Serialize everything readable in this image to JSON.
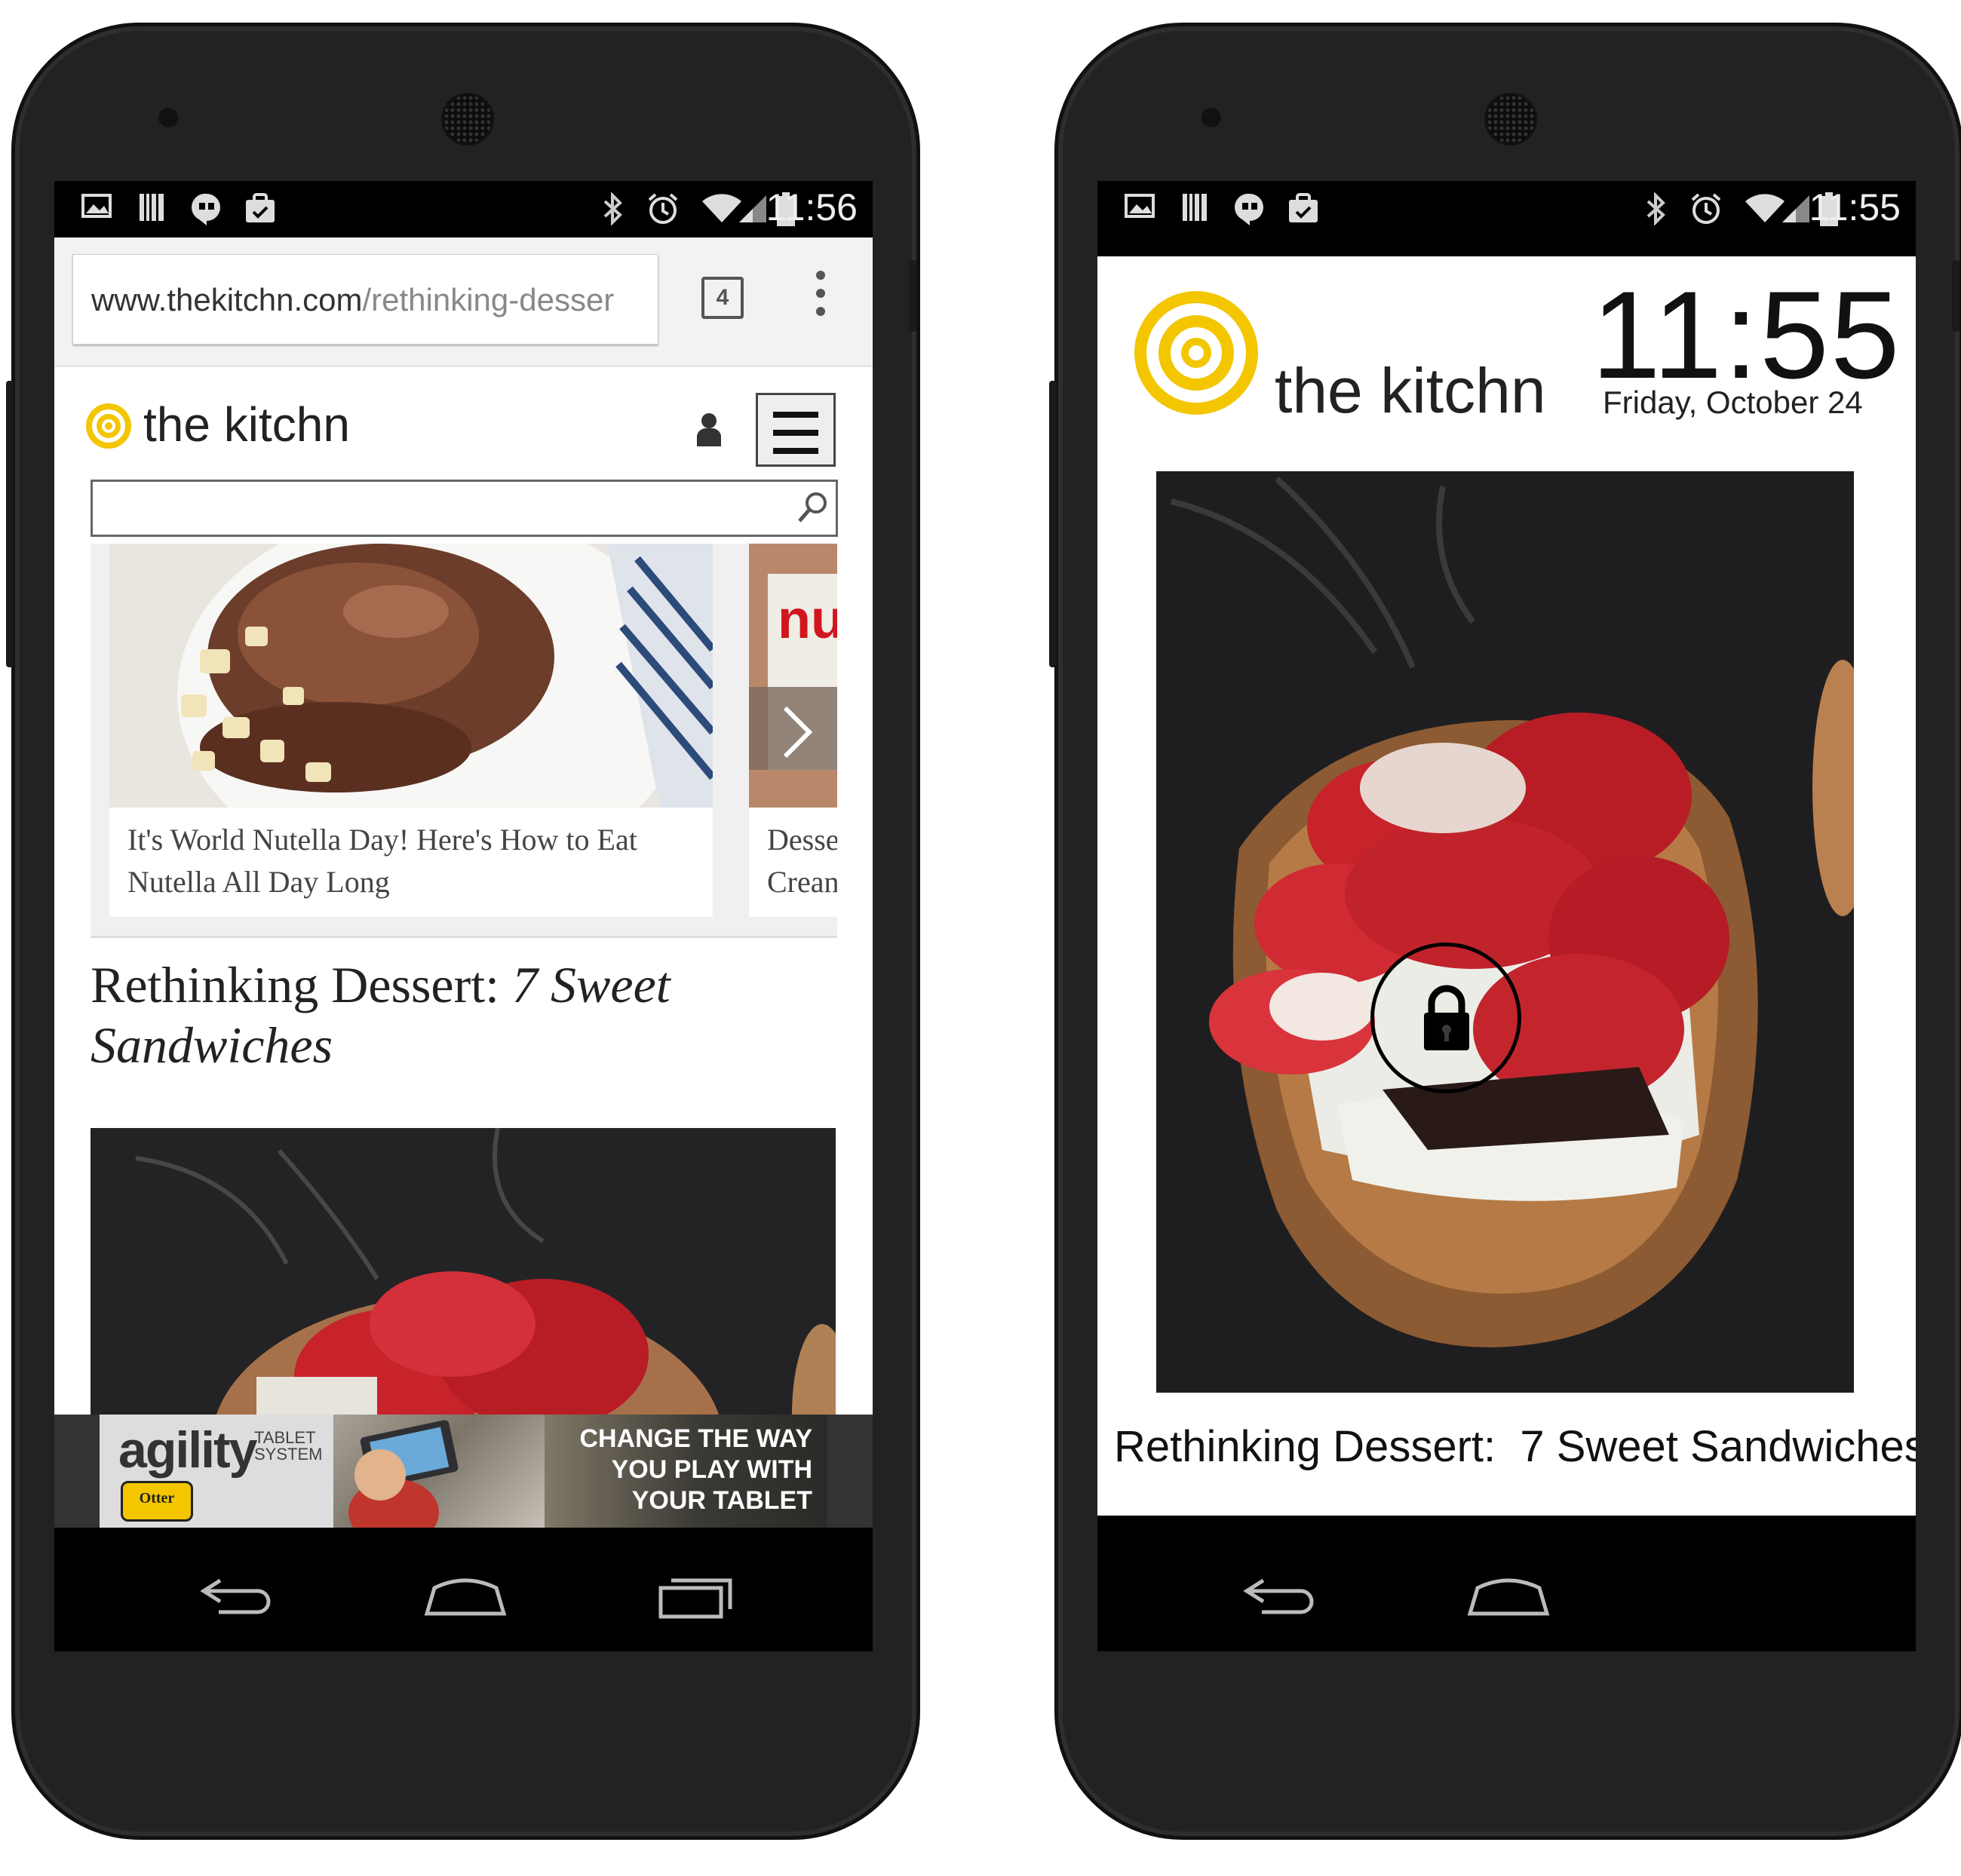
{
  "left_phone": {
    "status": {
      "time": "11:56"
    },
    "browser": {
      "url_domain": "www.thekitchn.com",
      "url_path": "/rethinking-desser",
      "tab_count": "4"
    },
    "site": {
      "name": "the kitchn",
      "search_placeholder": ""
    },
    "carousel": [
      {
        "title": "It's World Nutella Day! Here's How to Eat Nutella All Day Long"
      },
      {
        "title": "Desse\nCrean"
      }
    ],
    "article": {
      "title_plain": "Rethinking Dessert: ",
      "title_italic": "7 Sweet Sandwiches"
    },
    "ad": {
      "brand": "agility",
      "sub": "TABLET\nSYSTEM",
      "badge": "Otter",
      "text": "CHANGE THE WAY\nYOU PLAY WITH\nYOUR TABLET"
    }
  },
  "right_phone": {
    "status": {
      "time": "11:55"
    },
    "lock": {
      "site_name": "the kitchn",
      "time": "11:55",
      "date": "Friday, October 24",
      "caption": "Rethinking Dessert:  7 Sweet Sandwiches"
    }
  },
  "colors": {
    "brand_yellow": "#f3c600",
    "strawberry": "#c8222a"
  }
}
